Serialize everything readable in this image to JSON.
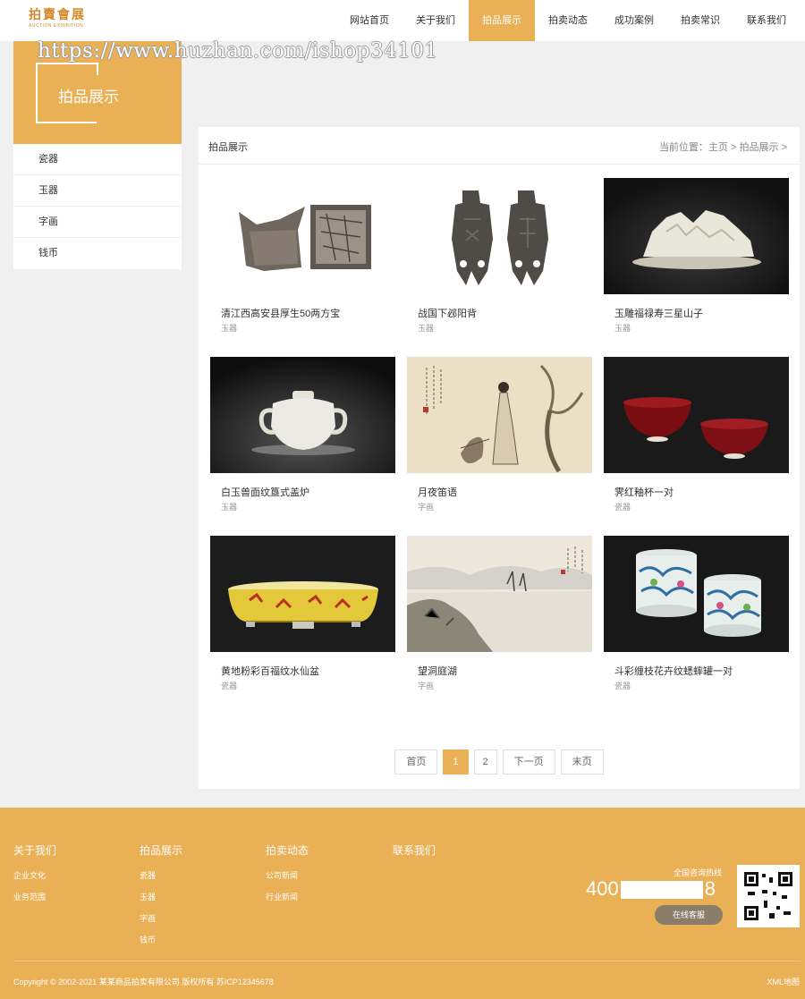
{
  "header": {
    "logo_cn": "拍賣會展",
    "logo_en": "AUCTION EXHIBITION",
    "nav": [
      "网站首页",
      "关于我们",
      "拍品展示",
      "拍卖动态",
      "成功案例",
      "拍卖常识",
      "联系我们"
    ],
    "active_nav": "拍品展示"
  },
  "watermark": "https://www.huzhan.com/ishop34101",
  "sidebar": {
    "title": "拍品展示",
    "items": [
      "瓷器",
      "玉器",
      "字画",
      "钱币"
    ]
  },
  "panel": {
    "title": "拍品展示",
    "breadcrumb_prefix": "当前位置：",
    "breadcrumb_home": "主页",
    "breadcrumb_sep": ">",
    "breadcrumb_current": "拍品展示",
    "breadcrumb_tail": ">"
  },
  "products": [
    {
      "name": "清江西高安县厚生50两方宝",
      "category": "玉器",
      "icon": "silver-ingot-image"
    },
    {
      "name": "战国下邲阳背",
      "category": "玉器",
      "icon": "ancient-coin-image"
    },
    {
      "name": "玉雕福禄寿三星山子",
      "category": "玉器",
      "icon": "jade-carving-image"
    },
    {
      "name": "白玉兽面纹簋式盖炉",
      "category": "玉器",
      "icon": "jade-censer-image"
    },
    {
      "name": "月夜笛语",
      "category": "字画",
      "icon": "painting-flute-image"
    },
    {
      "name": "霁红釉杯一对",
      "category": "瓷器",
      "icon": "red-cups-image"
    },
    {
      "name": "黄地粉彩百福纹水仙盆",
      "category": "瓷器",
      "icon": "yellow-basin-image"
    },
    {
      "name": "望洞庭湖",
      "category": "字画",
      "icon": "landscape-painting-image"
    },
    {
      "name": "斗彩缠枝花卉纹蟋蟀罐一对",
      "category": "瓷器",
      "icon": "blue-white-jars-image"
    }
  ],
  "pagination": {
    "first": "首页",
    "current": "1",
    "page2": "2",
    "next": "下一页",
    "last": "末页"
  },
  "footer": {
    "col1": {
      "title": "关于我们",
      "links": [
        "企业文化",
        "业务范围"
      ]
    },
    "col2": {
      "title": "拍品展示",
      "links": [
        "瓷器",
        "玉器",
        "字画",
        "钱币"
      ]
    },
    "col3": {
      "title": "拍卖动态",
      "links": [
        "公司新闻",
        "行业新闻"
      ]
    },
    "col4": {
      "title": "联系我们"
    },
    "hotline_label": "全国咨询热线",
    "hotline_start": "400",
    "hotline_end": "8",
    "online_service": "在线客服",
    "copyright": "Copyright © 2002-2021 某某商品拍卖有限公司 版权所有 苏ICP12345678",
    "xml": "XML地图"
  },
  "colors": {
    "accent": "#e9b055",
    "footer_bg": "#e9b055",
    "panel_bg": "#ffffff",
    "page_bg": "#f0f0f0"
  }
}
